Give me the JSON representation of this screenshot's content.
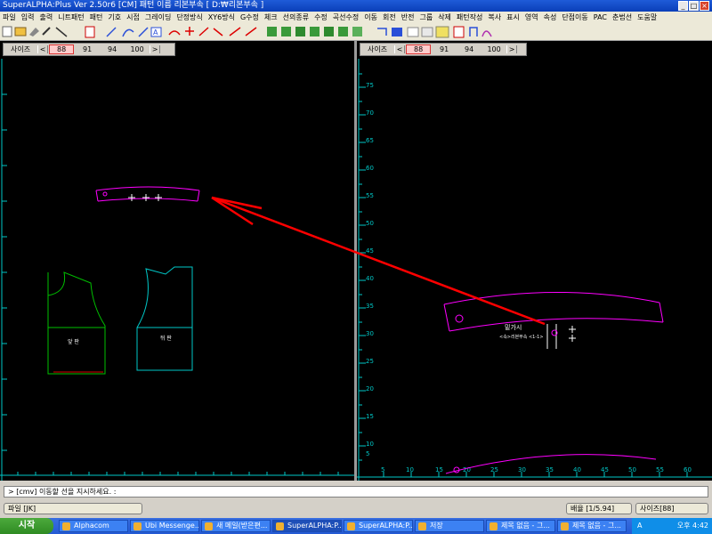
{
  "window": {
    "title": "SuperALPHA:Plus Ver 2.50r6 [CM]  패턴 이름 리본부속  [ D:₩리본부속 ]"
  },
  "menu": [
    "파일",
    "입력",
    "출력",
    "니트패턴",
    "패턴",
    "기호",
    "시접",
    "그레이딩",
    "단정방식",
    "XY6방식",
    "G수정",
    "체크",
    "선의종류",
    "수정",
    "곡선수정",
    "이동",
    "회전",
    "반전",
    "그룹",
    "삭제",
    "패턴작성",
    "복사",
    "표시",
    "영역",
    "속성",
    "단점이동",
    "PAC",
    "춘법선",
    "도움말"
  ],
  "left_panel": {
    "size_label": "사이즈",
    "sizes": [
      "88",
      "91",
      "94",
      "100"
    ],
    "active_size": "88",
    "arrow_left": "<",
    "arrow_right": ">",
    "piece_labels": [
      "앞 판",
      "뒤 판"
    ]
  },
  "right_panel": {
    "size_label": "사이즈",
    "sizes": [
      "88",
      "91",
      "94",
      "100"
    ],
    "active_size": "88",
    "arrow_left": "<",
    "arrow_right": ">",
    "y_ticks": [
      "75",
      "70",
      "65",
      "60",
      "55",
      "50",
      "45",
      "40",
      "35",
      "30",
      "25",
      "20",
      "15",
      "10",
      "5"
    ],
    "x_ticks": [
      "5",
      "10",
      "15",
      "20",
      "25",
      "30",
      "35",
      "40",
      "45",
      "50",
      "55",
      "60"
    ],
    "band_text_1": "밑가시",
    "band_text_2": "<속>리본부속 <1-1>"
  },
  "command": {
    "prompt": "> [cmv] 이동할 선을 지시하세요. :"
  },
  "status": {
    "file": "파일    [JK]",
    "scale": "배율 [1/5.94]",
    "size": "사이즈[88]"
  },
  "taskbar": {
    "start": "시작",
    "tasks": [
      "Alphacom",
      "Ubi Messenge...",
      "새 메일(받은편...",
      "SuperALPHA:P...",
      "SuperALPHA:P...",
      "저장",
      "제목 없음 - 그...",
      "제목 없음 - 그..."
    ],
    "clock": "오후 4:42",
    "tray_lang": "A"
  },
  "colors": {
    "pattern": "#ff00ff",
    "arrow": "#ff0000",
    "ruler": "#00c8c8",
    "front_piece": "#00c000",
    "back_piece": "#00c8c8"
  }
}
